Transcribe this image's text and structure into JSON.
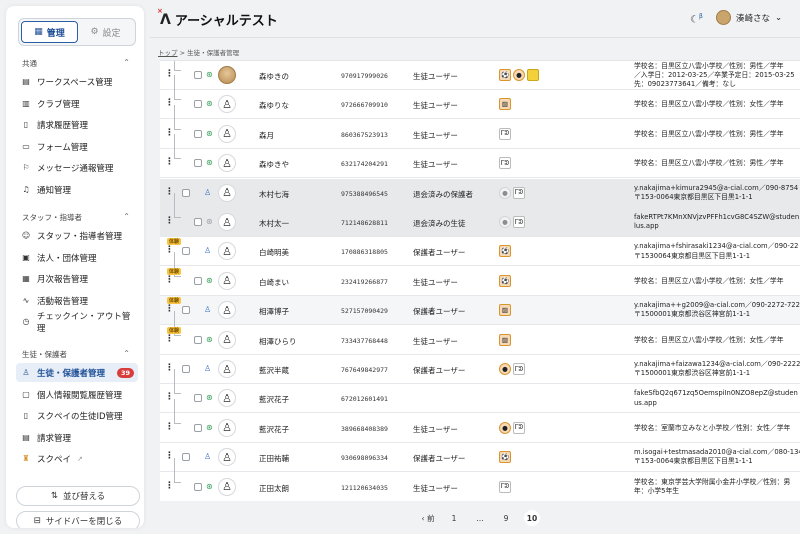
{
  "app": {
    "title": "アーシャルテスト",
    "user": "湊崎さな",
    "beta": "β"
  },
  "sidebar": {
    "tabs": [
      {
        "label": "管理",
        "active": true
      },
      {
        "label": "設定",
        "active": false
      }
    ],
    "sections": [
      {
        "title": "共通",
        "items": [
          {
            "label": "ワークスペース管理",
            "icon": "building-icon"
          },
          {
            "label": "クラブ管理",
            "icon": "book-icon"
          },
          {
            "label": "請求履歴管理",
            "icon": "document-icon"
          },
          {
            "label": "フォーム管理",
            "icon": "form-icon"
          },
          {
            "label": "メッセージ通報管理",
            "icon": "report-icon"
          },
          {
            "label": "通知管理",
            "icon": "bell-icon"
          }
        ]
      },
      {
        "title": "スタッフ・指導者",
        "items": [
          {
            "label": "スタッフ・指導者管理",
            "icon": "users-icon"
          },
          {
            "label": "法人・団体管理",
            "icon": "office-icon"
          },
          {
            "label": "月次報告管理",
            "icon": "calendar-icon"
          },
          {
            "label": "活動報告管理",
            "icon": "activity-icon"
          },
          {
            "label": "チェックイン・アウト管理",
            "icon": "clock-icon"
          }
        ]
      },
      {
        "title": "生徒・保護者",
        "items": [
          {
            "label": "生徒・保護者管理",
            "icon": "person-icon",
            "active": true,
            "badge": "39"
          },
          {
            "label": "個人情報閲覧履歴管理",
            "icon": "id-icon"
          },
          {
            "label": "スクペイの生徒ID管理",
            "icon": "document-icon"
          },
          {
            "label": "請求管理",
            "icon": "invoice-icon"
          },
          {
            "label": "スクペイ",
            "icon": "skupay-icon"
          }
        ]
      }
    ],
    "sort_button": "並び替える",
    "close_button": "サイドバーを閉じる"
  },
  "breadcrumb": {
    "home": "トップ",
    "current": "生徒・保護者管理",
    "sep": ">"
  },
  "rows": [
    {
      "name": "森ゆきの",
      "id": "970917999026",
      "type": "生徒ユーザー",
      "icons": [
        "soccer",
        "basketball",
        "yellow"
      ],
      "detail": [
        "学校名：目黒区立八雲小学校／性別：男性／学年",
        "／入学日：2012-03-25／卒業予定日：2015-03-25",
        "先：09023773641／備考：なし"
      ]
    },
    {
      "name": "森ゆりな",
      "id": "972666709910",
      "type": "生徒ユーザー",
      "icons": [
        "image"
      ],
      "detail": [
        "学校名：目黒区立八雲小学校／性別：女性／学年"
      ]
    },
    {
      "name": "森月",
      "id": "860367523913",
      "type": "生徒ユーザー",
      "icons": [
        "logo"
      ],
      "detail": [
        "学校名：目黒区立八雲小学校／性別：男性／学年"
      ]
    },
    {
      "name": "森ゆきや",
      "id": "632174204291",
      "type": "生徒ユーザー",
      "icons": [
        "logo"
      ],
      "detail": [
        "学校名：目黒区立八雲小学校／性別：男性／学年"
      ]
    },
    {
      "name": "木村七海",
      "id": "975388496545",
      "type": "退会済みの保護者",
      "icons": [
        "circle",
        "logo"
      ],
      "detail": [
        "y.nakajima+kimura2945@a-cial.com／090-8754",
        "〒153-0064東京都目黒区下目黒1-1-1"
      ]
    },
    {
      "name": "木村太一",
      "id": "712148628811",
      "type": "退会済みの生徒",
      "icons": [
        "circle",
        "logo"
      ],
      "detail": [
        "fakeRTPt7KMnXNVjzvPFFh1cvG8C4SZW@studen",
        "lus.app"
      ]
    },
    {
      "name": "白崎明美",
      "id": "170886318805",
      "type": "保護者ユーザー",
      "tag": "体験",
      "icons": [
        "soccer"
      ],
      "detail": [
        "y.nakajima+fshirasaki1234@a-cial.com／090-22",
        "〒1530064東京都目黒区下目黒1-1-1"
      ]
    },
    {
      "name": "白崎まい",
      "id": "232419266877",
      "type": "生徒ユーザー",
      "tag": "体験",
      "icons": [
        "soccer"
      ],
      "detail": [
        "学校名：目黒区立八雲小学校／性別：女性／学年"
      ]
    },
    {
      "name": "相澤博子",
      "id": "527157090429",
      "type": "保護者ユーザー",
      "tag": "体験",
      "icons": [
        "image"
      ],
      "detail": [
        "y.nakajima++g2009@a-cial.com／090-2272-7222",
        "〒1500001東京都渋谷区神宮前1-1-1"
      ]
    },
    {
      "name": "相澤ひらり",
      "id": "733437768448",
      "type": "生徒ユーザー",
      "tag": "体験",
      "icons": [
        "image"
      ],
      "detail": [
        "学校名：目黒区立八雲小学校／性別：女性／学年"
      ]
    },
    {
      "name": "藍沢半蔵",
      "id": "767649842977",
      "type": "保護者ユーザー",
      "icons": [
        "basketball",
        "logo"
      ],
      "detail": [
        "y.nakajima+faizawa1234@a-cial.com／090-2222",
        "〒1500001東京都渋谷区神宮前1-1-1"
      ]
    },
    {
      "name": "藍沢花子",
      "id": "672012601491",
      "type": "",
      "icons": [],
      "detail": [
        "fakeSfbQ2q671zq5OemspiIn0NZO8epZ@studen",
        "us.app"
      ]
    },
    {
      "name": "藍沢花子",
      "id": "389668408389",
      "type": "生徒ユーザー",
      "icons": [
        "basketball",
        "logo"
      ],
      "detail": [
        "学校名：室蘭市立みなと小学校／性別：女性／学年"
      ]
    },
    {
      "name": "正田祐輔",
      "id": "930698096334",
      "type": "保護者ユーザー",
      "icons": [
        "soccer"
      ],
      "detail": [
        "m.isogai+testmasada2010@a-cial.com／080-134",
        "〒153-0064東京都目黒区下目黒1-1-1"
      ]
    },
    {
      "name": "正田太朗",
      "id": "121120634035",
      "type": "生徒ユーザー",
      "icons": [
        "logo"
      ],
      "detail": [
        "学校名：東京学芸大学附属小金井小学校／性別：男",
        "年：小学5年生"
      ]
    }
  ],
  "pagination": {
    "prev": "前",
    "pages": [
      "1",
      "…",
      "9",
      "10"
    ],
    "current": "10"
  }
}
